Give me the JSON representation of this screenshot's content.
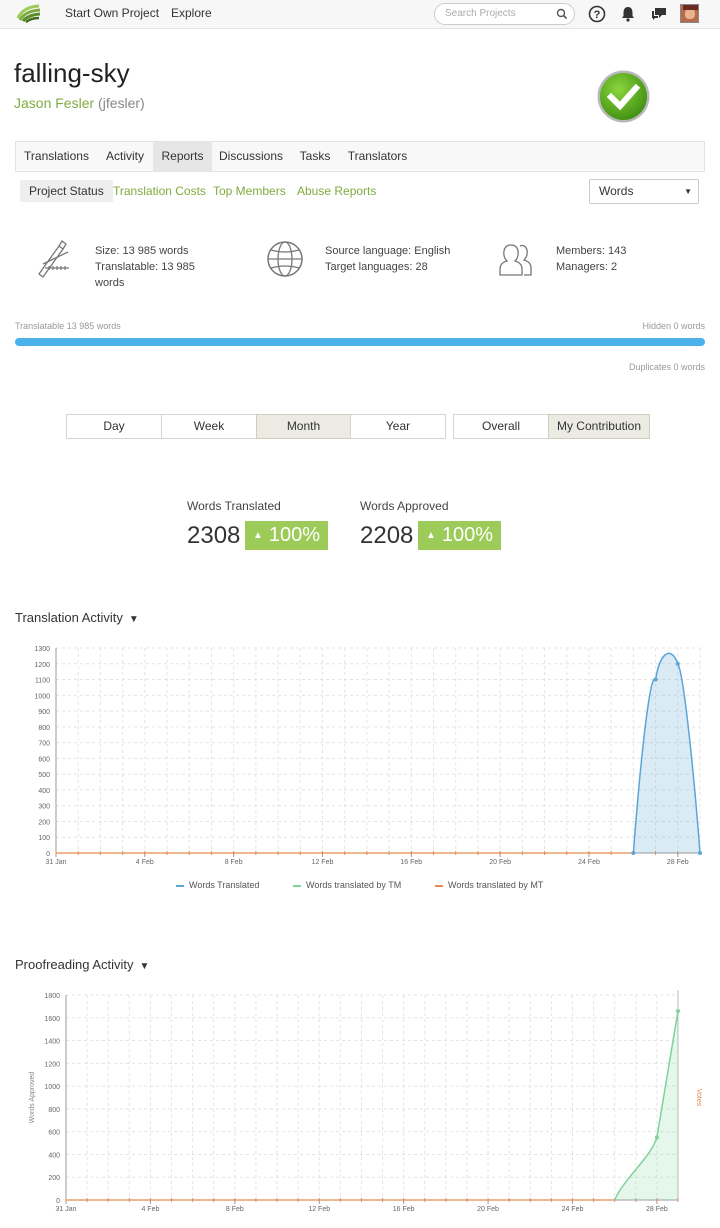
{
  "topbar": {
    "start_project": "Start Own Project",
    "explore": "Explore",
    "search_placeholder": "Search Projects"
  },
  "project": {
    "title": "falling-sky",
    "owner_name": "Jason Fesler",
    "owner_handle": "(jfesler)"
  },
  "tabs": [
    "Translations",
    "Activity",
    "Reports",
    "Discussions",
    "Tasks",
    "Translators"
  ],
  "active_tab": "Reports",
  "subtabs": [
    "Project Status",
    "Translation Costs",
    "Top Members",
    "Abuse Reports"
  ],
  "active_subtab": "Project Status",
  "unit_select": "Words",
  "stats": {
    "size": "Size: 13 985 words",
    "translatable_l1": "Translatable: 13 985",
    "translatable_l2": "words",
    "source": "Source language: English",
    "targets": "Target languages: 28",
    "members": "Members: 143",
    "managers": "Managers: 2"
  },
  "progress": {
    "translatable_label": "Translatable 13 985 words",
    "hidden_label": "Hidden 0 words",
    "duplicates_label": "Duplicates 0 words",
    "translatable_fraction": 1.0
  },
  "periods": [
    "Day",
    "Week",
    "Month",
    "Year"
  ],
  "active_period": "Month",
  "scopes": [
    "Overall",
    "My Contribution"
  ],
  "active_scope": "My Contribution",
  "kpis": {
    "translated_label": "Words Translated",
    "translated_value": "2308",
    "translated_change": "100%",
    "approved_label": "Words Approved",
    "approved_value": "2208",
    "approved_change": "100%"
  },
  "translation_section": "Translation Activity",
  "proofreading_section": "Proofreading Activity",
  "legend": {
    "words_translated": "Words Translated",
    "by_tm": "Words translated by TM",
    "by_mt": "Words translated by MT"
  },
  "colors": {
    "accent_green": "#7fab3f",
    "badge_green": "#9ccb59",
    "progress_blue": "#4bb1ea",
    "series_blue": "#5aa6d6",
    "series_green": "#7fd39a",
    "series_orange": "#e58a57"
  },
  "chart_data": [
    {
      "type": "area",
      "x_ticks": [
        "31 Jan",
        "4 Feb",
        "8 Feb",
        "12 Feb",
        "16 Feb",
        "20 Feb",
        "24 Feb",
        "28 Feb"
      ],
      "ylim": [
        0,
        1300
      ],
      "y_ticks": [
        0,
        100,
        200,
        300,
        400,
        500,
        600,
        700,
        800,
        900,
        1000,
        1100,
        1200,
        1300
      ],
      "grid": true,
      "legend_position": "bottom",
      "series": [
        {
          "name": "Words Translated",
          "color": "#5aa6d6",
          "x": [
            "26 Feb",
            "27 Feb",
            "28 Feb",
            "29 Feb"
          ],
          "values": [
            0,
            1100,
            1200,
            0
          ]
        },
        {
          "name": "Words translated by TM",
          "color": "#7fd39a",
          "values": []
        },
        {
          "name": "Words translated by MT",
          "color": "#e58a57",
          "values": [
            0
          ]
        }
      ]
    },
    {
      "type": "area",
      "x_ticks": [
        "31 Jan",
        "4 Feb",
        "8 Feb",
        "12 Feb",
        "16 Feb",
        "20 Feb",
        "24 Feb",
        "28 Feb"
      ],
      "ylabel": "Words Approved",
      "y2label": "Votes",
      "ylim": [
        0,
        1800
      ],
      "y_ticks": [
        0,
        200,
        400,
        600,
        800,
        1000,
        1200,
        1400,
        1600,
        1800
      ],
      "grid": true,
      "series": [
        {
          "name": "Words Approved",
          "color": "#7fd39a",
          "x": [
            "26 Feb",
            "28 Feb",
            "29 Feb"
          ],
          "values": [
            0,
            550,
            1660
          ]
        },
        {
          "name": "Votes",
          "color": "#e58a57",
          "values": [
            0
          ]
        }
      ]
    }
  ]
}
